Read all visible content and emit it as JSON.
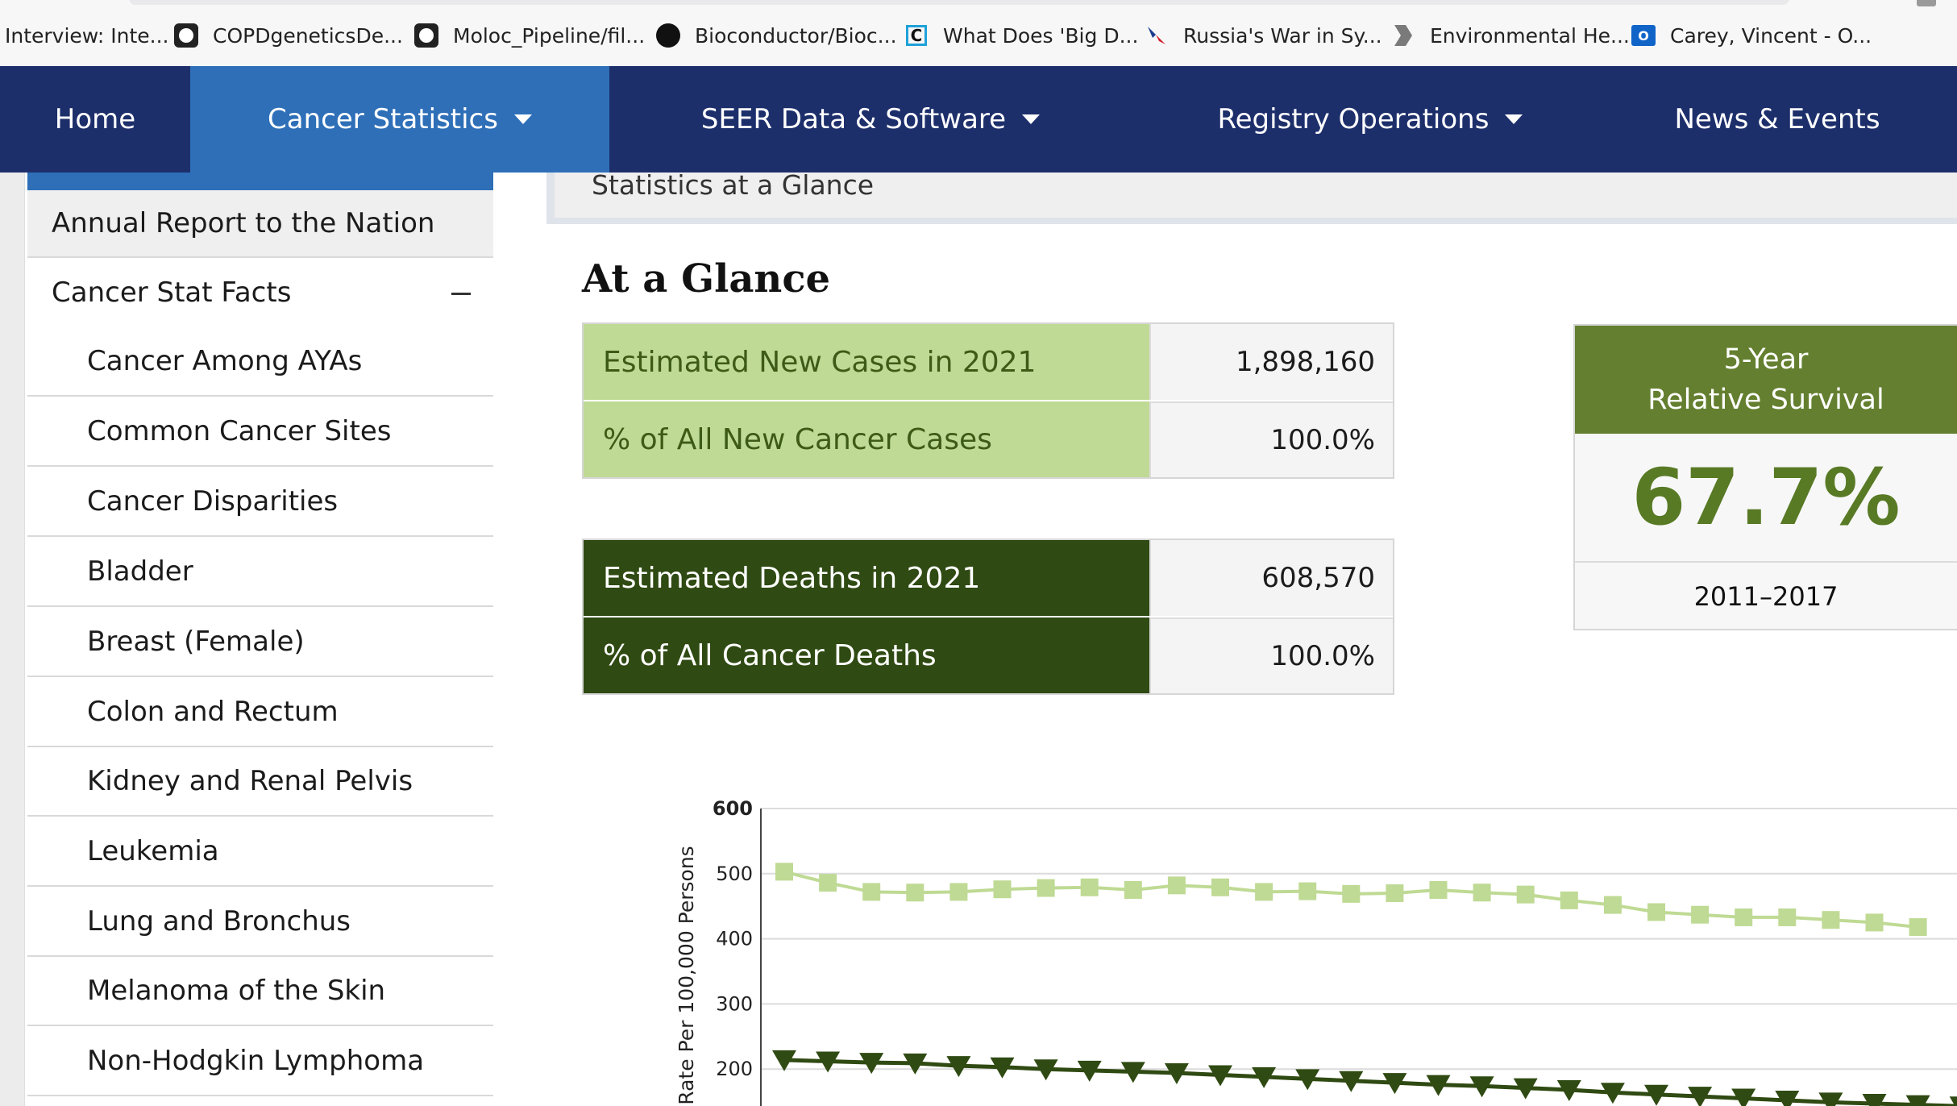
{
  "bookmarks": [
    {
      "label": "Interview: Inte...",
      "icon": "none"
    },
    {
      "label": "COPDgeneticsDe...",
      "icon": "github-icon"
    },
    {
      "label": "Moloc_Pipeline/fil...",
      "icon": "github-icon"
    },
    {
      "label": "Bioconductor/Bioc...",
      "icon": "github-icon"
    },
    {
      "label": "What Does 'Big D...",
      "icon": "c-logo-icon"
    },
    {
      "label": "Russia's War in Sy...",
      "icon": "airline-icon"
    },
    {
      "label": "Environmental He...",
      "icon": "chevron-logo-icon"
    },
    {
      "label": "Carey, Vincent - O...",
      "icon": "outlook-icon"
    }
  ],
  "nav": {
    "items": [
      {
        "label": "Home"
      },
      {
        "label": "Cancer Statistics",
        "dropdown": true,
        "active": true
      },
      {
        "label": "SEER Data & Software",
        "dropdown": true
      },
      {
        "label": "Registry Operations",
        "dropdown": true
      },
      {
        "label": "News & Events"
      }
    ]
  },
  "sidebar": {
    "items": [
      {
        "label": "Annual Report to the Nation"
      },
      {
        "label": "Cancer Stat Facts",
        "expanded": true
      },
      {
        "label": "Cancer Among AYAs"
      },
      {
        "label": "Common Cancer Sites"
      },
      {
        "label": "Cancer Disparities"
      },
      {
        "label": "Bladder"
      },
      {
        "label": "Breast (Female)"
      },
      {
        "label": "Colon and Rectum"
      },
      {
        "label": "Kidney and Renal Pelvis"
      },
      {
        "label": "Leukemia"
      },
      {
        "label": "Lung and Bronchus"
      },
      {
        "label": "Melanoma of the Skin"
      },
      {
        "label": "Non-Hodgkin Lymphoma"
      }
    ]
  },
  "main": {
    "breadcrumb": "Statistics at a Glance",
    "title": "At a Glance",
    "new_cases": {
      "rows": [
        {
          "label": "Estimated New Cases in 2021",
          "value": "1,898,160"
        },
        {
          "label": "% of All New Cancer Cases",
          "value": "100.0%"
        }
      ]
    },
    "deaths": {
      "rows": [
        {
          "label": "Estimated Deaths in 2021",
          "value": "608,570"
        },
        {
          "label": "% of All Cancer Deaths",
          "value": "100.0%"
        }
      ]
    },
    "survival": {
      "title_line1": "5-Year",
      "title_line2": "Relative Survival",
      "value": "67.7%",
      "years": "2011–2017"
    }
  },
  "colors": {
    "nav_bg": "#1d2f6b",
    "nav_active": "#2e6fb8",
    "light_green": "#bfda94",
    "dark_green": "#2f4a12",
    "survival_header": "#647f2f",
    "survival_text": "#587a25"
  },
  "chart_data": {
    "type": "line",
    "ylabel": "Rate Per 100,000 Persons",
    "ylim": [
      0,
      600
    ],
    "yticks": [
      200,
      300,
      400,
      500,
      600
    ],
    "grid": true,
    "series": [
      {
        "marker": "square",
        "color": "#bfda94",
        "values": [
          503,
          486,
          472,
          471,
          472,
          476,
          478,
          479,
          475,
          482,
          479,
          472,
          473,
          469,
          470,
          475,
          471,
          468,
          459,
          452,
          441,
          437,
          433,
          433,
          429,
          425,
          418
        ]
      },
      {
        "marker": "triangle-down",
        "color": "#2f4a12",
        "values": [
          214,
          212,
          210,
          209,
          205,
          203,
          200,
          198,
          196,
          194,
          191,
          188,
          185,
          182,
          179,
          176,
          174,
          171,
          168,
          164,
          161,
          158,
          155,
          152,
          149,
          147,
          145,
          143
        ]
      }
    ]
  }
}
